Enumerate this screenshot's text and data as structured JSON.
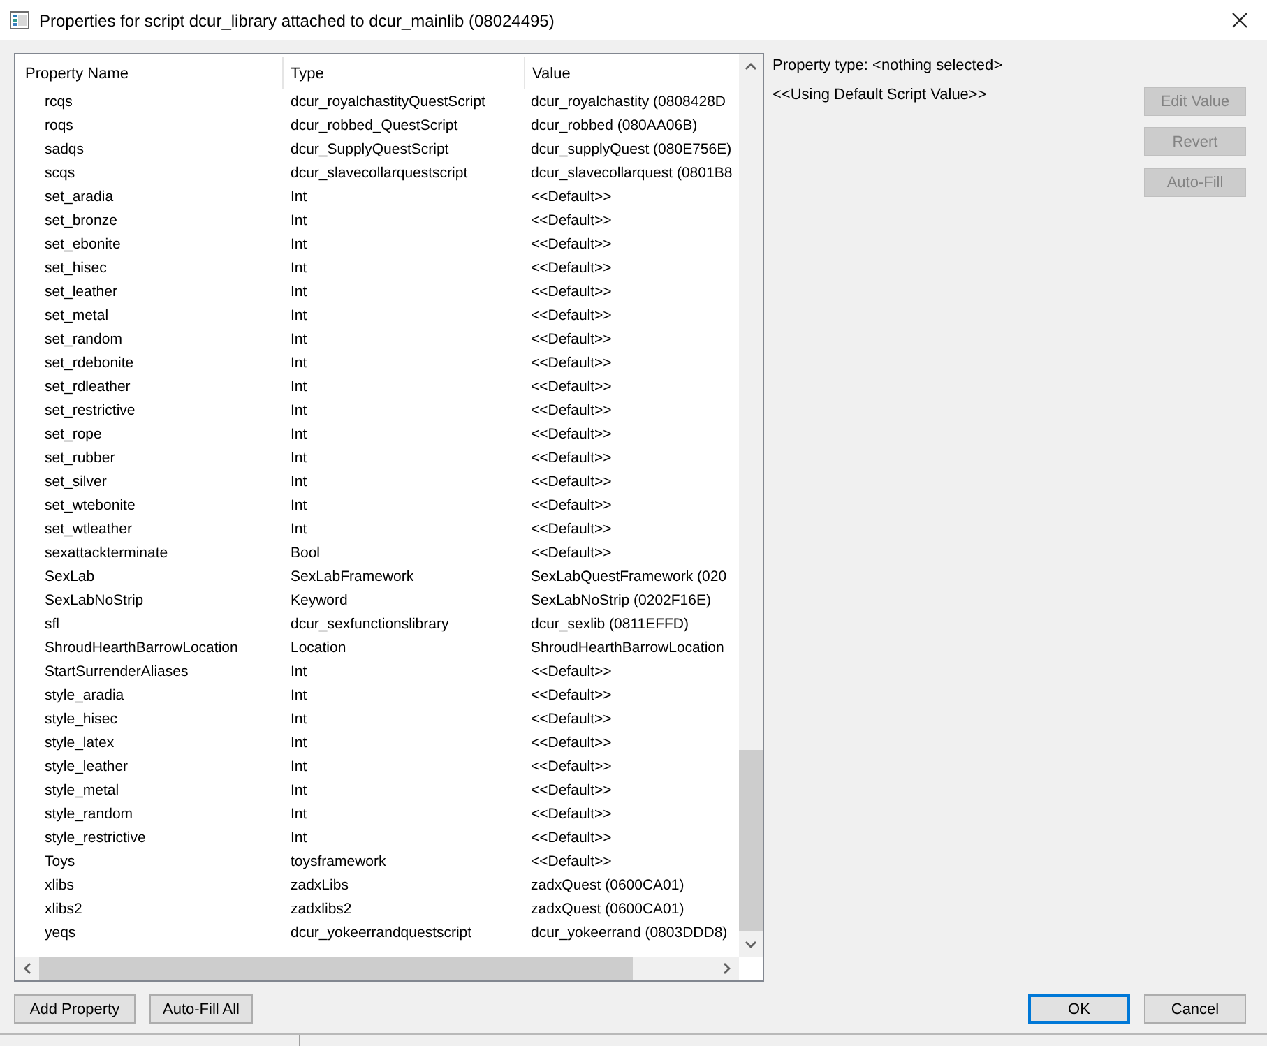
{
  "window": {
    "title": "Properties for script dcur_library attached to dcur_mainlib (08024495)"
  },
  "properties_table": {
    "columns": [
      "Property Name",
      "Type",
      "Value"
    ],
    "rows": [
      {
        "name": "rcqs",
        "type": "dcur_royalchastityQuestScript",
        "value": "dcur_royalchastity (0808428D",
        "selected": false
      },
      {
        "name": "roqs",
        "type": "dcur_robbed_QuestScript",
        "value": "dcur_robbed (080AA06B)",
        "selected": false
      },
      {
        "name": "sadqs",
        "type": "dcur_SupplyQuestScript",
        "value": "dcur_supplyQuest (080E756E)",
        "selected": false
      },
      {
        "name": "scqs",
        "type": "dcur_slavecollarquestscript",
        "value": "dcur_slavecollarquest (0801B8",
        "selected": false
      },
      {
        "name": "set_aradia",
        "type": "Int",
        "value": "<<Default>>",
        "selected": false
      },
      {
        "name": "set_bronze",
        "type": "Int",
        "value": "<<Default>>",
        "selected": false
      },
      {
        "name": "set_ebonite",
        "type": "Int",
        "value": "<<Default>>",
        "selected": false
      },
      {
        "name": "set_hisec",
        "type": "Int",
        "value": "<<Default>>",
        "selected": false
      },
      {
        "name": "set_leather",
        "type": "Int",
        "value": "<<Default>>",
        "selected": false
      },
      {
        "name": "set_metal",
        "type": "Int",
        "value": "<<Default>>",
        "selected": false
      },
      {
        "name": "set_random",
        "type": "Int",
        "value": "<<Default>>",
        "selected": false
      },
      {
        "name": "set_rdebonite",
        "type": "Int",
        "value": "<<Default>>",
        "selected": false
      },
      {
        "name": "set_rdleather",
        "type": "Int",
        "value": "<<Default>>",
        "selected": false
      },
      {
        "name": "set_restrictive",
        "type": "Int",
        "value": "<<Default>>",
        "selected": false
      },
      {
        "name": "set_rope",
        "type": "Int",
        "value": "<<Default>>",
        "selected": false
      },
      {
        "name": "set_rubber",
        "type": "Int",
        "value": "<<Default>>",
        "selected": false
      },
      {
        "name": "set_silver",
        "type": "Int",
        "value": "<<Default>>",
        "selected": false
      },
      {
        "name": "set_wtebonite",
        "type": "Int",
        "value": "<<Default>>",
        "selected": false
      },
      {
        "name": "set_wtleather",
        "type": "Int",
        "value": "<<Default>>",
        "selected": false
      },
      {
        "name": "sexattackterminate",
        "type": "Bool",
        "value": "<<Default>>",
        "selected": false
      },
      {
        "name": "SexLab",
        "type": "SexLabFramework",
        "value": "SexLabQuestFramework (020",
        "selected": false
      },
      {
        "name": "SexLabNoStrip",
        "type": "Keyword",
        "value": "SexLabNoStrip (0202F16E)",
        "selected": false
      },
      {
        "name": "sfl",
        "type": "dcur_sexfunctionslibrary",
        "value": "dcur_sexlib (0811EFFD)",
        "selected": false
      },
      {
        "name": "ShroudHearthBarrowLocation",
        "type": "Location",
        "value": "ShroudHearthBarrowLocation",
        "selected": false
      },
      {
        "name": "StartSurrenderAliases",
        "type": "Int",
        "value": "<<Default>>",
        "selected": false
      },
      {
        "name": "style_aradia",
        "type": "Int",
        "value": "<<Default>>",
        "selected": false
      },
      {
        "name": "style_hisec",
        "type": "Int",
        "value": "<<Default>>",
        "selected": false
      },
      {
        "name": "style_latex",
        "type": "Int",
        "value": "<<Default>>",
        "selected": false
      },
      {
        "name": "style_leather",
        "type": "Int",
        "value": "<<Default>>",
        "selected": false
      },
      {
        "name": "style_metal",
        "type": "Int",
        "value": "<<Default>>",
        "selected": false
      },
      {
        "name": "style_random",
        "type": "Int",
        "value": "<<Default>>",
        "selected": false
      },
      {
        "name": "style_restrictive",
        "type": "Int",
        "value": "<<Default>>",
        "selected": false
      },
      {
        "name": "Toys",
        "type": "toysframework",
        "value": "<<Default>>",
        "selected": false
      },
      {
        "name": "xlibs",
        "type": "zadxLibs",
        "value": "zadxQuest (0600CA01)",
        "selected": false
      },
      {
        "name": "xlibs2",
        "type": "zadxlibs2",
        "value": "zadxQuest (0600CA01)",
        "selected": false
      },
      {
        "name": "yeqs",
        "type": "dcur_yokeerrandquestscript",
        "value": "dcur_yokeerrand (0803DDD8)",
        "selected": false
      }
    ]
  },
  "details": {
    "property_type": "Property type: <nothing selected>",
    "value_note": "<<Using Default Script Value>>",
    "buttons": [
      {
        "label": "Edit Value",
        "disabled": true
      },
      {
        "label": "Revert",
        "disabled": true
      },
      {
        "label": "Auto-Fill",
        "disabled": true
      }
    ]
  },
  "footer": {
    "left_buttons": [
      {
        "label": "Add Property",
        "default": false
      },
      {
        "label": "Auto-Fill All",
        "default": false
      }
    ],
    "right_buttons": [
      {
        "label": "OK",
        "default": true
      },
      {
        "label": "Cancel",
        "default": false
      }
    ]
  }
}
